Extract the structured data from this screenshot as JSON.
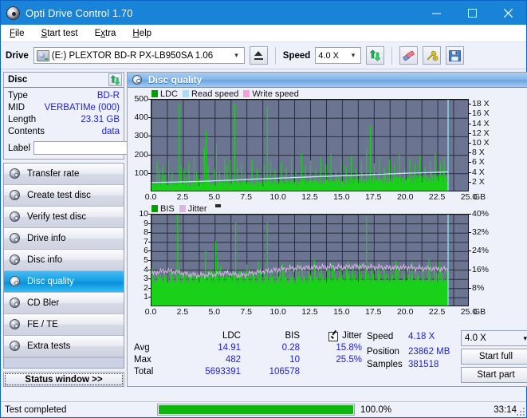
{
  "window": {
    "title": "Opti Drive Control 1.70",
    "logo_icon": "disc-logo-icon",
    "minimize_label": "–",
    "maximize_label": "□",
    "close_label": "✕"
  },
  "menu": {
    "items": [
      {
        "label": "File",
        "mnemonic": "F"
      },
      {
        "label": "Start test",
        "mnemonic": "S"
      },
      {
        "label": "Extra",
        "mnemonic": "x"
      },
      {
        "label": "Help",
        "mnemonic": "H"
      }
    ]
  },
  "toolbar": {
    "drive_label": "Drive",
    "drive_value": "(E:)   PLEXTOR BD-R  PX-LB950SA 1.06",
    "eject_label": "eject",
    "speed_label": "Speed",
    "speed_value": "4.0 X",
    "refresh_icon": "refresh-icon",
    "erase_icon": "eraser-icon",
    "tools_icon": "tools-icon",
    "save_icon": "save-icon"
  },
  "disc": {
    "header": "Disc",
    "refresh_icon": "refresh-icon",
    "rows": [
      {
        "key": "Type",
        "value": "BD-R"
      },
      {
        "key": "MID",
        "value": "VERBATIMe (000)"
      },
      {
        "key": "Length",
        "value": "23.31 GB"
      },
      {
        "key": "Contents",
        "value": "data"
      }
    ],
    "label_key": "Label",
    "label_value": "",
    "label_placeholder": "",
    "disc_button_icon": "cd-icon"
  },
  "sidebar": {
    "items": [
      {
        "label": "Transfer rate",
        "active": false
      },
      {
        "label": "Create test disc",
        "active": false
      },
      {
        "label": "Verify test disc",
        "active": false
      },
      {
        "label": "Drive info",
        "active": false
      },
      {
        "label": "Disc info",
        "active": false
      },
      {
        "label": "Disc quality",
        "active": true
      },
      {
        "label": "CD Bler",
        "active": false
      },
      {
        "label": "FE / TE",
        "active": false
      },
      {
        "label": "Extra tests",
        "active": false
      }
    ],
    "status_window_label": "Status window >>"
  },
  "panel": {
    "title": "Disc quality",
    "icon": "disc-quality-icon"
  },
  "chart_data": [
    {
      "type": "line",
      "id": "ldc-chart",
      "title": "",
      "xlabel": "GB",
      "ylabel": "",
      "xlim": [
        0.0,
        25.0
      ],
      "ylim": [
        0,
        500
      ],
      "x_ticks": [
        "0.0",
        "2.5",
        "5.0",
        "7.5",
        "10.0",
        "12.5",
        "15.0",
        "17.5",
        "20.0",
        "22.5",
        "25.0"
      ],
      "x_unit": "GB",
      "y_ticks": [
        100,
        200,
        300,
        400,
        500
      ],
      "y2_ticks": [
        "2 X",
        "4 X",
        "6 X",
        "8 X",
        "10 X",
        "12 X",
        "14 X",
        "16 X",
        "18 X"
      ],
      "y2lim": [
        0,
        19
      ],
      "grid": true,
      "legend_position": "top",
      "legend": [
        {
          "name": "LDC",
          "color": "#00a000"
        },
        {
          "name": "Read speed",
          "color": "#a8dcf0"
        },
        {
          "name": "Write speed",
          "color": "#f49fd8"
        }
      ],
      "data_end_gb": 23.31,
      "series": [
        {
          "name": "LDC",
          "color": "#19d119",
          "type": "spike",
          "baseline": [
            48,
            50,
            52,
            52,
            54,
            55,
            55,
            56,
            56,
            57,
            58,
            58,
            59,
            60,
            61,
            62,
            63,
            64,
            65,
            66,
            67,
            68,
            69,
            70,
            72,
            74,
            76,
            78,
            80,
            82,
            84,
            86,
            88,
            90,
            92
          ],
          "spikes": [
            {
              "x": 0.45,
              "y": 168
            },
            {
              "x": 0.62,
              "y": 120
            },
            {
              "x": 0.88,
              "y": 142
            },
            {
              "x": 1.05,
              "y": 96
            },
            {
              "x": 1.35,
              "y": 176
            },
            {
              "x": 1.62,
              "y": 108
            },
            {
              "x": 2.18,
              "y": 482
            },
            {
              "x": 2.32,
              "y": 140
            },
            {
              "x": 2.55,
              "y": 124
            },
            {
              "x": 2.95,
              "y": 166
            },
            {
              "x": 3.35,
              "y": 196
            },
            {
              "x": 3.55,
              "y": 108
            },
            {
              "x": 4.15,
              "y": 240
            },
            {
              "x": 4.3,
              "y": 336
            },
            {
              "x": 4.45,
              "y": 142
            },
            {
              "x": 4.95,
              "y": 126
            },
            {
              "x": 5.1,
              "y": 262
            },
            {
              "x": 5.35,
              "y": 118
            },
            {
              "x": 5.75,
              "y": 186
            },
            {
              "x": 5.95,
              "y": 148
            },
            {
              "x": 6.2,
              "y": 176
            },
            {
              "x": 6.55,
              "y": 482
            },
            {
              "x": 6.75,
              "y": 132
            },
            {
              "x": 7.1,
              "y": 158
            },
            {
              "x": 7.35,
              "y": 104
            },
            {
              "x": 7.9,
              "y": 176
            },
            {
              "x": 8.3,
              "y": 128
            },
            {
              "x": 8.85,
              "y": 150
            },
            {
              "x": 9.1,
              "y": 466
            },
            {
              "x": 9.35,
              "y": 172
            },
            {
              "x": 9.7,
              "y": 122
            },
            {
              "x": 10.2,
              "y": 160
            },
            {
              "x": 10.6,
              "y": 138
            },
            {
              "x": 11.0,
              "y": 192
            },
            {
              "x": 11.35,
              "y": 118
            },
            {
              "x": 11.8,
              "y": 208
            },
            {
              "x": 12.1,
              "y": 146
            },
            {
              "x": 12.5,
              "y": 172
            },
            {
              "x": 12.9,
              "y": 126
            },
            {
              "x": 13.3,
              "y": 188
            },
            {
              "x": 13.7,
              "y": 150
            },
            {
              "x": 14.1,
              "y": 204
            },
            {
              "x": 14.5,
              "y": 132
            },
            {
              "x": 14.9,
              "y": 178
            },
            {
              "x": 15.3,
              "y": 144
            },
            {
              "x": 15.7,
              "y": 196
            },
            {
              "x": 16.1,
              "y": 126
            },
            {
              "x": 16.5,
              "y": 170
            },
            {
              "x": 16.9,
              "y": 240
            },
            {
              "x": 17.2,
              "y": 360
            },
            {
              "x": 17.5,
              "y": 156
            },
            {
              "x": 17.9,
              "y": 190
            },
            {
              "x": 18.3,
              "y": 134
            },
            {
              "x": 18.7,
              "y": 176
            },
            {
              "x": 19.1,
              "y": 148
            },
            {
              "x": 19.5,
              "y": 204
            },
            {
              "x": 19.9,
              "y": 128
            },
            {
              "x": 20.3,
              "y": 182
            },
            {
              "x": 20.7,
              "y": 154
            },
            {
              "x": 21.1,
              "y": 198
            },
            {
              "x": 21.5,
              "y": 136
            },
            {
              "x": 21.9,
              "y": 172
            },
            {
              "x": 22.3,
              "y": 210
            },
            {
              "x": 22.7,
              "y": 158
            },
            {
              "x": 23.0,
              "y": 186
            }
          ]
        },
        {
          "name": "Read speed",
          "color": "#bde4f5",
          "type": "line",
          "points": [
            {
              "x": 0.0,
              "y": 2.0
            },
            {
              "x": 1.0,
              "y": 2.05
            },
            {
              "x": 2.0,
              "y": 2.1
            },
            {
              "x": 3.5,
              "y": 2.2
            },
            {
              "x": 5.0,
              "y": 2.35
            },
            {
              "x": 6.5,
              "y": 2.5
            },
            {
              "x": 8.0,
              "y": 2.7
            },
            {
              "x": 9.5,
              "y": 2.85
            },
            {
              "x": 11.0,
              "y": 3.0
            },
            {
              "x": 12.5,
              "y": 3.15
            },
            {
              "x": 14.0,
              "y": 3.3
            },
            {
              "x": 15.5,
              "y": 3.45
            },
            {
              "x": 17.0,
              "y": 3.6
            },
            {
              "x": 18.5,
              "y": 3.75
            },
            {
              "x": 20.0,
              "y": 3.9
            },
            {
              "x": 21.5,
              "y": 4.0
            },
            {
              "x": 23.3,
              "y": 4.18
            }
          ]
        }
      ]
    },
    {
      "type": "line",
      "id": "bis-jitter-chart",
      "title": "",
      "xlabel": "GB",
      "ylabel": "",
      "xlim": [
        0.0,
        25.0
      ],
      "ylim": [
        0,
        10
      ],
      "x_ticks": [
        "0.0",
        "2.5",
        "5.0",
        "7.5",
        "10.0",
        "12.5",
        "15.0",
        "17.5",
        "20.0",
        "22.5",
        "25.0"
      ],
      "x_unit": "GB",
      "y_ticks": [
        1,
        2,
        3,
        4,
        5,
        6,
        7,
        8,
        9,
        10
      ],
      "y2_ticks": [
        "8%",
        "16%",
        "24%",
        "32%",
        "40%"
      ],
      "y2lim": [
        0,
        40
      ],
      "grid": true,
      "legend_position": "top",
      "legend": [
        {
          "name": "BIS",
          "color": "#00a000"
        },
        {
          "name": "Jitter",
          "color": "#d9b6e0"
        }
      ],
      "data_end_gb": 23.31,
      "series": [
        {
          "name": "BIS",
          "color": "#19d119",
          "type": "spike",
          "baseline_level": 3.1,
          "spikes": [
            {
              "x": 2.05,
              "y": 10.0
            },
            {
              "x": 2.62,
              "y": 2.2
            },
            {
              "x": 4.25,
              "y": 6.1
            },
            {
              "x": 5.05,
              "y": 7.1
            },
            {
              "x": 5.2,
              "y": 5.2
            },
            {
              "x": 6.62,
              "y": 9.2
            },
            {
              "x": 7.5,
              "y": 4.6
            },
            {
              "x": 8.4,
              "y": 5.0
            },
            {
              "x": 9.1,
              "y": 9.1
            },
            {
              "x": 10.3,
              "y": 4.8
            },
            {
              "x": 11.6,
              "y": 4.9
            },
            {
              "x": 12.8,
              "y": 5.1
            },
            {
              "x": 14.2,
              "y": 4.7
            },
            {
              "x": 15.4,
              "y": 5.0
            },
            {
              "x": 16.9,
              "y": 9.9
            },
            {
              "x": 17.9,
              "y": 4.8
            },
            {
              "x": 19.2,
              "y": 5.0
            },
            {
              "x": 20.5,
              "y": 4.9
            },
            {
              "x": 21.8,
              "y": 5.2
            },
            {
              "x": 22.6,
              "y": 4.9
            }
          ]
        },
        {
          "name": "Jitter",
          "color": "#d6b2e6",
          "type": "line",
          "points": [
            {
              "x": 0.0,
              "y": 3.6
            },
            {
              "x": 1.0,
              "y": 3.95
            },
            {
              "x": 2.0,
              "y": 3.8
            },
            {
              "x": 3.0,
              "y": 3.5
            },
            {
              "x": 4.0,
              "y": 3.45
            },
            {
              "x": 5.0,
              "y": 3.55
            },
            {
              "x": 6.0,
              "y": 3.7
            },
            {
              "x": 7.0,
              "y": 3.4
            },
            {
              "x": 8.0,
              "y": 3.7
            },
            {
              "x": 9.0,
              "y": 3.9
            },
            {
              "x": 10.0,
              "y": 4.05
            },
            {
              "x": 11.0,
              "y": 4.2
            },
            {
              "x": 12.0,
              "y": 4.25
            },
            {
              "x": 13.0,
              "y": 4.3
            },
            {
              "x": 14.0,
              "y": 4.35
            },
            {
              "x": 15.0,
              "y": 4.3
            },
            {
              "x": 16.0,
              "y": 4.4
            },
            {
              "x": 17.0,
              "y": 4.35
            },
            {
              "x": 18.0,
              "y": 4.3
            },
            {
              "x": 19.0,
              "y": 4.25
            },
            {
              "x": 20.0,
              "y": 4.3
            },
            {
              "x": 21.0,
              "y": 4.2
            },
            {
              "x": 22.0,
              "y": 4.15
            },
            {
              "x": 23.3,
              "y": 4.1
            }
          ]
        }
      ]
    }
  ],
  "stats": {
    "col_ldc": "LDC",
    "col_bis": "BIS",
    "col_jitter": "Jitter",
    "jitter_checked": true,
    "rows": [
      {
        "key": "Avg",
        "ldc": "14.91",
        "bis": "0.28",
        "jitter": "15.8%"
      },
      {
        "key": "Max",
        "ldc": "482",
        "bis": "10",
        "jitter": "25.5%"
      },
      {
        "key": "Total",
        "ldc": "5693391",
        "bis": "106578",
        "jitter": ""
      }
    ]
  },
  "results": {
    "speed_key": "Speed",
    "speed_value": "4.18 X",
    "position_key": "Position",
    "position_value": "23862 MB",
    "samples_key": "Samples",
    "samples_value": "381518",
    "speed_select": "4.0 X",
    "start_full_label": "Start full",
    "start_part_label": "Start part"
  },
  "statusbar": {
    "message": "Test completed",
    "progress_percent": 100.0,
    "progress_text": "100.0%",
    "elapsed": "33:14"
  },
  "colors": {
    "accent": "#1883d7",
    "value_text": "#2222cc",
    "ldc_green": "#19d119",
    "plot_bg": "#6b7490",
    "progress_green": "#10b510"
  }
}
